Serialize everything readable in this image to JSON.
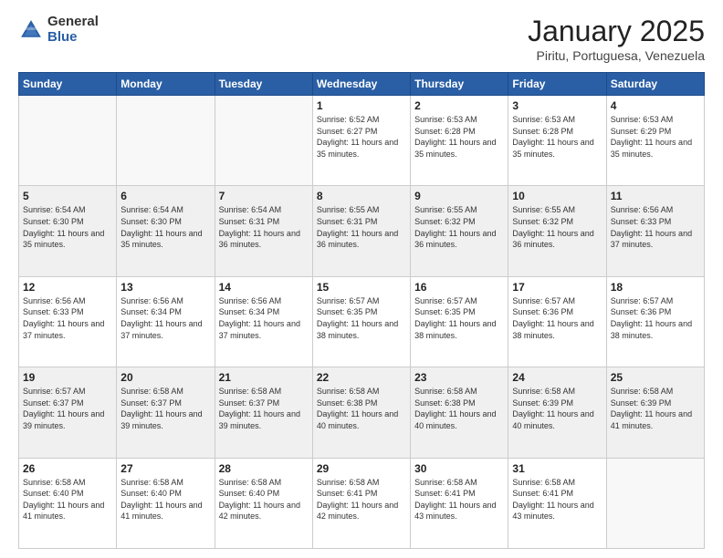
{
  "logo": {
    "general": "General",
    "blue": "Blue"
  },
  "header": {
    "month": "January 2025",
    "location": "Piritu, Portuguesa, Venezuela"
  },
  "weekdays": [
    "Sunday",
    "Monday",
    "Tuesday",
    "Wednesday",
    "Thursday",
    "Friday",
    "Saturday"
  ],
  "weeks": [
    [
      {
        "day": null,
        "empty": true
      },
      {
        "day": null,
        "empty": true
      },
      {
        "day": null,
        "empty": true
      },
      {
        "day": 1,
        "sunrise": "6:52 AM",
        "sunset": "6:27 PM",
        "daylight": "11 hours and 35 minutes."
      },
      {
        "day": 2,
        "sunrise": "6:53 AM",
        "sunset": "6:28 PM",
        "daylight": "11 hours and 35 minutes."
      },
      {
        "day": 3,
        "sunrise": "6:53 AM",
        "sunset": "6:28 PM",
        "daylight": "11 hours and 35 minutes."
      },
      {
        "day": 4,
        "sunrise": "6:53 AM",
        "sunset": "6:29 PM",
        "daylight": "11 hours and 35 minutes."
      }
    ],
    [
      {
        "day": 5,
        "sunrise": "6:54 AM",
        "sunset": "6:30 PM",
        "daylight": "11 hours and 35 minutes."
      },
      {
        "day": 6,
        "sunrise": "6:54 AM",
        "sunset": "6:30 PM",
        "daylight": "11 hours and 35 minutes."
      },
      {
        "day": 7,
        "sunrise": "6:54 AM",
        "sunset": "6:31 PM",
        "daylight": "11 hours and 36 minutes."
      },
      {
        "day": 8,
        "sunrise": "6:55 AM",
        "sunset": "6:31 PM",
        "daylight": "11 hours and 36 minutes."
      },
      {
        "day": 9,
        "sunrise": "6:55 AM",
        "sunset": "6:32 PM",
        "daylight": "11 hours and 36 minutes."
      },
      {
        "day": 10,
        "sunrise": "6:55 AM",
        "sunset": "6:32 PM",
        "daylight": "11 hours and 36 minutes."
      },
      {
        "day": 11,
        "sunrise": "6:56 AM",
        "sunset": "6:33 PM",
        "daylight": "11 hours and 37 minutes."
      }
    ],
    [
      {
        "day": 12,
        "sunrise": "6:56 AM",
        "sunset": "6:33 PM",
        "daylight": "11 hours and 37 minutes."
      },
      {
        "day": 13,
        "sunrise": "6:56 AM",
        "sunset": "6:34 PM",
        "daylight": "11 hours and 37 minutes."
      },
      {
        "day": 14,
        "sunrise": "6:56 AM",
        "sunset": "6:34 PM",
        "daylight": "11 hours and 37 minutes."
      },
      {
        "day": 15,
        "sunrise": "6:57 AM",
        "sunset": "6:35 PM",
        "daylight": "11 hours and 38 minutes."
      },
      {
        "day": 16,
        "sunrise": "6:57 AM",
        "sunset": "6:35 PM",
        "daylight": "11 hours and 38 minutes."
      },
      {
        "day": 17,
        "sunrise": "6:57 AM",
        "sunset": "6:36 PM",
        "daylight": "11 hours and 38 minutes."
      },
      {
        "day": 18,
        "sunrise": "6:57 AM",
        "sunset": "6:36 PM",
        "daylight": "11 hours and 38 minutes."
      }
    ],
    [
      {
        "day": 19,
        "sunrise": "6:57 AM",
        "sunset": "6:37 PM",
        "daylight": "11 hours and 39 minutes."
      },
      {
        "day": 20,
        "sunrise": "6:58 AM",
        "sunset": "6:37 PM",
        "daylight": "11 hours and 39 minutes."
      },
      {
        "day": 21,
        "sunrise": "6:58 AM",
        "sunset": "6:37 PM",
        "daylight": "11 hours and 39 minutes."
      },
      {
        "day": 22,
        "sunrise": "6:58 AM",
        "sunset": "6:38 PM",
        "daylight": "11 hours and 40 minutes."
      },
      {
        "day": 23,
        "sunrise": "6:58 AM",
        "sunset": "6:38 PM",
        "daylight": "11 hours and 40 minutes."
      },
      {
        "day": 24,
        "sunrise": "6:58 AM",
        "sunset": "6:39 PM",
        "daylight": "11 hours and 40 minutes."
      },
      {
        "day": 25,
        "sunrise": "6:58 AM",
        "sunset": "6:39 PM",
        "daylight": "11 hours and 41 minutes."
      }
    ],
    [
      {
        "day": 26,
        "sunrise": "6:58 AM",
        "sunset": "6:40 PM",
        "daylight": "11 hours and 41 minutes."
      },
      {
        "day": 27,
        "sunrise": "6:58 AM",
        "sunset": "6:40 PM",
        "daylight": "11 hours and 41 minutes."
      },
      {
        "day": 28,
        "sunrise": "6:58 AM",
        "sunset": "6:40 PM",
        "daylight": "11 hours and 42 minutes."
      },
      {
        "day": 29,
        "sunrise": "6:58 AM",
        "sunset": "6:41 PM",
        "daylight": "11 hours and 42 minutes."
      },
      {
        "day": 30,
        "sunrise": "6:58 AM",
        "sunset": "6:41 PM",
        "daylight": "11 hours and 43 minutes."
      },
      {
        "day": 31,
        "sunrise": "6:58 AM",
        "sunset": "6:41 PM",
        "daylight": "11 hours and 43 minutes."
      },
      {
        "day": null,
        "empty": true
      }
    ]
  ]
}
